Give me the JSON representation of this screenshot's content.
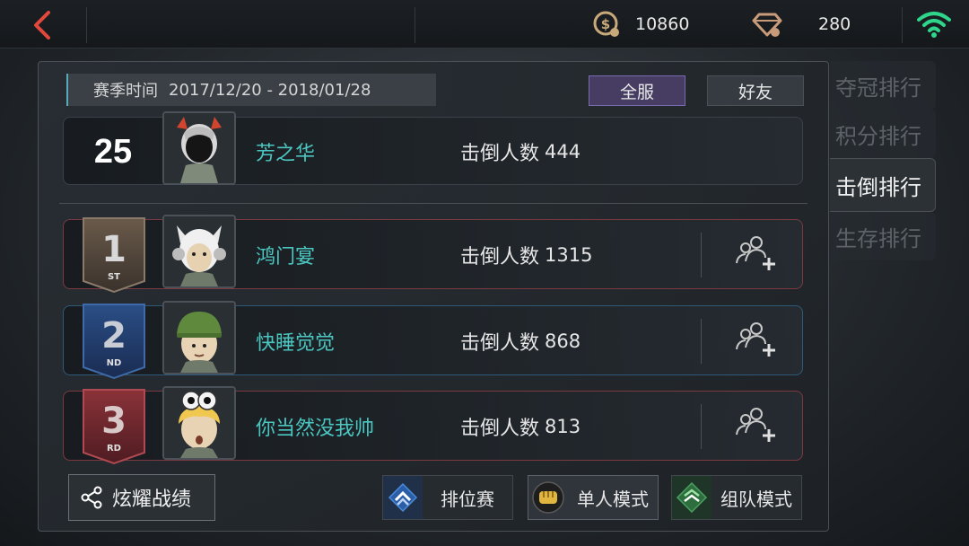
{
  "currency": {
    "coins": "10860",
    "gems": "280"
  },
  "season": {
    "label": "赛季时间",
    "range": "2017/12/20 - 2018/01/28"
  },
  "filters": {
    "all": "全服",
    "friends": "好友"
  },
  "my_entry": {
    "rank": "25",
    "name": "芳之华",
    "kills_label": "击倒人数",
    "kills": "444"
  },
  "leaderboard": [
    {
      "rank": "1",
      "suffix": "ST",
      "name": "鸿门宴",
      "kills_label": "击倒人数",
      "kills": "1315"
    },
    {
      "rank": "2",
      "suffix": "ND",
      "name": "快睡觉觉",
      "kills_label": "击倒人数",
      "kills": "868"
    },
    {
      "rank": "3",
      "suffix": "RD",
      "name": "你当然没我帅",
      "kills_label": "击倒人数",
      "kills": "813"
    }
  ],
  "side_tabs": [
    {
      "label": "夺冠排行"
    },
    {
      "label": "积分排行"
    },
    {
      "label": "击倒排行"
    },
    {
      "label": "生存排行"
    }
  ],
  "bottom": {
    "share": "炫耀战绩",
    "ranked": "排位赛",
    "solo": "单人模式",
    "squad": "组队模式"
  },
  "colors": {
    "accent_teal": "#4bc6c0",
    "wifi_green": "#2fd58a",
    "back_red": "#e2483c"
  }
}
